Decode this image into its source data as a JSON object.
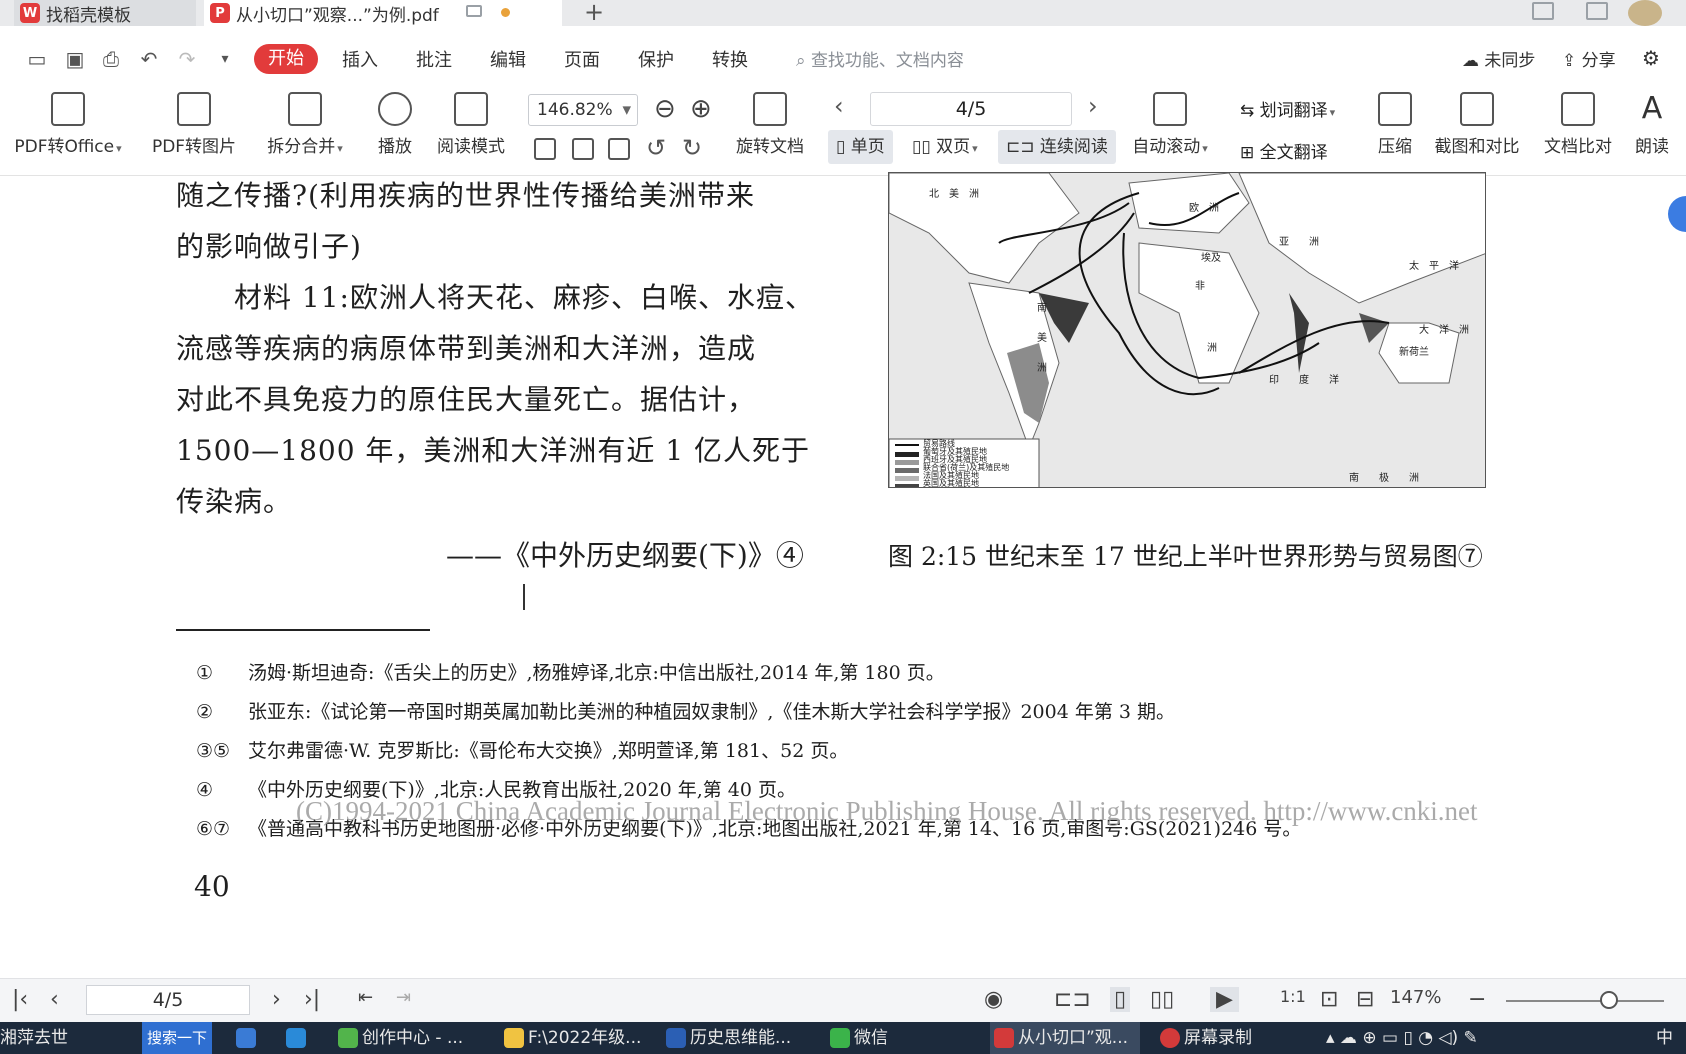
{
  "tabs": [
    {
      "label": "找稻壳模板"
    },
    {
      "label": "从小切口”观察...”为例.pdf"
    }
  ],
  "menu": {
    "items": [
      "开始",
      "插入",
      "批注",
      "编辑",
      "页面",
      "保护",
      "转换"
    ],
    "search_placeholder": "查找功能、文档内容",
    "sync_label": "未同步",
    "share_label": "分享"
  },
  "ribbon": {
    "pdf_to_office": "PDF转Office",
    "pdf_to_image": "PDF转图片",
    "split_merge": "拆分合并",
    "play": "播放",
    "read_mode": "阅读模式",
    "zoom_value": "146.82%",
    "rotate_doc": "旋转文档",
    "page_value": "4/5",
    "single_page": "单页",
    "double_page": "双页",
    "continuous": "连续阅读",
    "auto_scroll": "自动滚动",
    "word_translate": "划词翻译",
    "full_translate": "全文翻译",
    "compress": "压缩",
    "screenshot_compare": "截图和对比",
    "doc_compare": "文档比对",
    "read_aloud": "朗读"
  },
  "document": {
    "body_lines": [
      "随之传播?(利用疾病的世界性传播给美洲带来",
      "的影响做引子)",
      "　　材料 11:欧洲人将天花、麻疹、白喉、水痘、",
      "流感等疾病的病原体带到美洲和大洋洲，造成",
      "对此不具免疫力的原住民大量死亡。据估计，",
      "1500—1800 年，美洲和大洋洲有近 1 亿人死于",
      "传染病。"
    ],
    "source_line": "——《中外历史纲要(下)》④",
    "map_caption": "图 2:15 世纪末至 17 世纪上半叶世界形势与贸易图⑦",
    "map_legend": [
      "贸易路线",
      "葡萄牙及其殖民地",
      "西班牙及其殖民地",
      "联合省(荷兰)及其殖民地",
      "法国及其殖民地",
      "英国及其殖民地"
    ],
    "map_labels": {
      "north_america": "北　美　洲",
      "europe": "欧　洲",
      "asia": "亚　　洲",
      "africa": "非",
      "egypt": "埃及",
      "south_america": "南",
      "south_america_2": "美",
      "south_america_3": "洲",
      "africa_2": "洲",
      "india_ocean": "印　　度　　洋",
      "pacific": "太　平　洋",
      "oceania": "大　洋　洲",
      "new_holland": "新荷兰",
      "antarctic": "南　　极　　洲"
    },
    "footnotes": [
      {
        "mark": "①",
        "text": "汤姆·斯坦迪奇:《舌尖上的历史》,杨雅婷译,北京:中信出版社,2014 年,第 180 页。"
      },
      {
        "mark": "②",
        "text": "张亚东:《试论第一帝国时期英属加勒比美洲的种植园奴隶制》,《佳木斯大学社会科学学报》2004 年第 3 期。"
      },
      {
        "mark": "③⑤",
        "text": "艾尔弗雷德·W. 克罗斯比:《哥伦布大交换》,郑明萱译,第 181、52 页。"
      },
      {
        "mark": "④",
        "text": "《中外历史纲要(下)》,北京:人民教育出版社,2020 年,第 40 页。"
      },
      {
        "mark": "⑥⑦",
        "text": "《普通高中教科书历史地图册·必修·中外历史纲要(下)》,北京:地图出版社,2021 年,第 14、16 页,审图号:GS(2021)246 号。"
      }
    ],
    "watermark": "(C)1994-2021 China Academic Journal Electronic Publishing House. All rights reserved.    http://www.cnki.net",
    "page_number": "40"
  },
  "statusbar": {
    "page_value": "4/5",
    "zoom_value": "147%"
  },
  "taskbar": {
    "left_text": "湘萍去世",
    "search_label": "搜索一下",
    "items": [
      "创作中心 - ...",
      "F:\\2022年级...",
      "历史思维能...",
      "微信",
      "从小切口”观...",
      "屏幕录制"
    ],
    "ime": "中"
  }
}
